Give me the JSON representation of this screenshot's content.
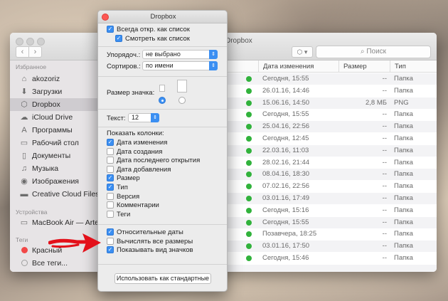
{
  "finder": {
    "title": "Dropbox",
    "search_placeholder": "Поиск",
    "nav_back": "‹",
    "nav_forward": "›",
    "share_icon": "dropbox-icon",
    "columns": {
      "date": "Дата изменения",
      "size": "Размер",
      "type": "Тип"
    },
    "sidebar": {
      "favorites_header": "Избранное",
      "favorites": [
        {
          "label": "akozoriz",
          "icon": "home-icon"
        },
        {
          "label": "Загрузки",
          "icon": "download-icon"
        },
        {
          "label": "Dropbox",
          "icon": "dropbox-icon"
        },
        {
          "label": "iCloud Drive",
          "icon": "cloud-icon"
        },
        {
          "label": "Программы",
          "icon": "apps-icon"
        },
        {
          "label": "Рабочий стол",
          "icon": "desktop-icon"
        },
        {
          "label": "Документы",
          "icon": "document-icon"
        },
        {
          "label": "Музыка",
          "icon": "music-icon"
        },
        {
          "label": "Изображения",
          "icon": "camera-icon"
        },
        {
          "label": "Creative Cloud Files",
          "icon": "folder-icon"
        }
      ],
      "devices_header": "Устройства",
      "devices": [
        {
          "label": "MacBook Air — Artem",
          "icon": "laptop-icon"
        }
      ],
      "tags_header": "Теги",
      "tags": [
        {
          "label": "Красный",
          "color": "#f24848"
        },
        {
          "label": "Все теги...",
          "color": ""
        }
      ]
    },
    "rows": [
      {
        "date": "Сегодня, 15:55",
        "size": "--",
        "type": "Папка"
      },
      {
        "date": "26.01.16, 14:46",
        "size": "--",
        "type": "Папка"
      },
      {
        "date": "15.06.16, 14:50",
        "size": "2,8 МБ",
        "type": "PNG"
      },
      {
        "date": "Сегодня, 15:55",
        "size": "--",
        "type": "Папка"
      },
      {
        "date": "25.04.16, 22:56",
        "size": "--",
        "type": "Папка"
      },
      {
        "date": "Сегодня, 12:45",
        "size": "--",
        "type": "Папка"
      },
      {
        "date": "22.03.16, 11:03",
        "size": "--",
        "type": "Папка"
      },
      {
        "date": "28.02.16, 21:44",
        "size": "--",
        "type": "Папка"
      },
      {
        "date": "08.04.16, 18:30",
        "size": "--",
        "type": "Папка"
      },
      {
        "date": "07.02.16, 22:56",
        "size": "--",
        "type": "Папка"
      },
      {
        "date": "03.01.16, 17:49",
        "size": "--",
        "type": "Папка"
      },
      {
        "date": "Сегодня, 15:16",
        "size": "--",
        "type": "Папка"
      },
      {
        "date": "Сегодня, 15:55",
        "size": "--",
        "type": "Папка"
      },
      {
        "date": "Позавчера, 18:25",
        "size": "--",
        "type": "Папка"
      },
      {
        "date": "03.01.16, 17:50",
        "size": "--",
        "type": "Папка"
      },
      {
        "date": "Сегодня, 15:46",
        "size": "--",
        "type": "Папка"
      }
    ]
  },
  "options": {
    "title": "Dropbox",
    "always_list": {
      "label": "Всегда откр. как список",
      "checked": true
    },
    "browse_list": {
      "label": "Смотреть как список",
      "checked": true
    },
    "arrange": {
      "label": "Упорядоч.:",
      "value": "не выбрано"
    },
    "sort": {
      "label": "Сортиров.:",
      "value": "по имени"
    },
    "icon_size_label": "Размер значка:",
    "text": {
      "label": "Текст:",
      "value": "12"
    },
    "columns_label": "Показать колонки:",
    "columns": [
      {
        "label": "Дата изменения",
        "checked": true
      },
      {
        "label": "Дата создания",
        "checked": false
      },
      {
        "label": "Дата последнего открытия",
        "checked": false
      },
      {
        "label": "Дата добавления",
        "checked": false
      },
      {
        "label": "Размер",
        "checked": true
      },
      {
        "label": "Тип",
        "checked": true
      },
      {
        "label": "Версия",
        "checked": false
      },
      {
        "label": "Комментарии",
        "checked": false
      },
      {
        "label": "Теги",
        "checked": false
      }
    ],
    "extras": [
      {
        "label": "Относительные даты",
        "checked": true
      },
      {
        "label": "Вычислять все размеры",
        "checked": false
      },
      {
        "label": "Показывать вид значков",
        "checked": true
      }
    ],
    "use_default_button": "Использовать как стандартные",
    "accent_color": "#3b8ff2"
  }
}
